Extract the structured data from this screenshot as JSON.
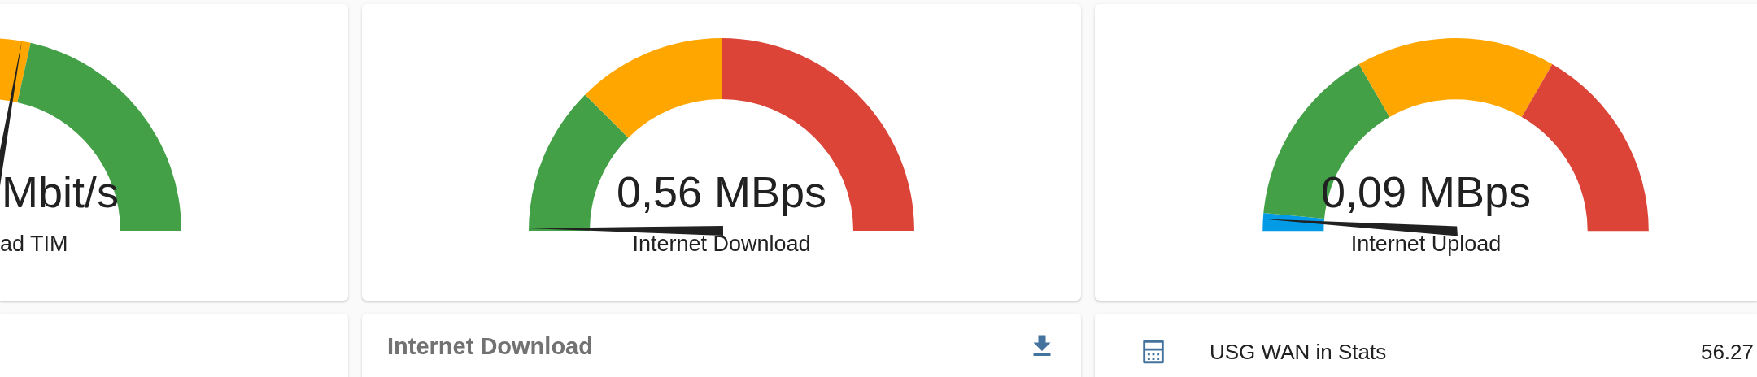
{
  "gauges": [
    {
      "value": "Mbit/s",
      "name": "ad TIM",
      "segments": [
        {
          "color": "#ffa600"
        },
        {
          "color": "#43a047"
        }
      ]
    },
    {
      "value": "0,56 MBps",
      "name": "Internet Download",
      "segments": [
        {
          "color": "#43a047"
        },
        {
          "color": "#ffa600"
        },
        {
          "color": "#db4437"
        }
      ]
    },
    {
      "value": "0,09 MBps",
      "name": "Internet Upload",
      "segments": [
        {
          "color": "#039be5"
        },
        {
          "color": "#43a047"
        },
        {
          "color": "#ffa600"
        },
        {
          "color": "#db4437"
        }
      ]
    }
  ],
  "cards": [
    {
      "kind": "empty"
    },
    {
      "kind": "header",
      "title": "Internet Download"
    },
    {
      "kind": "entities",
      "rows": [
        {
          "name": "USG WAN in Stats",
          "value": "56.27"
        }
      ]
    }
  ]
}
